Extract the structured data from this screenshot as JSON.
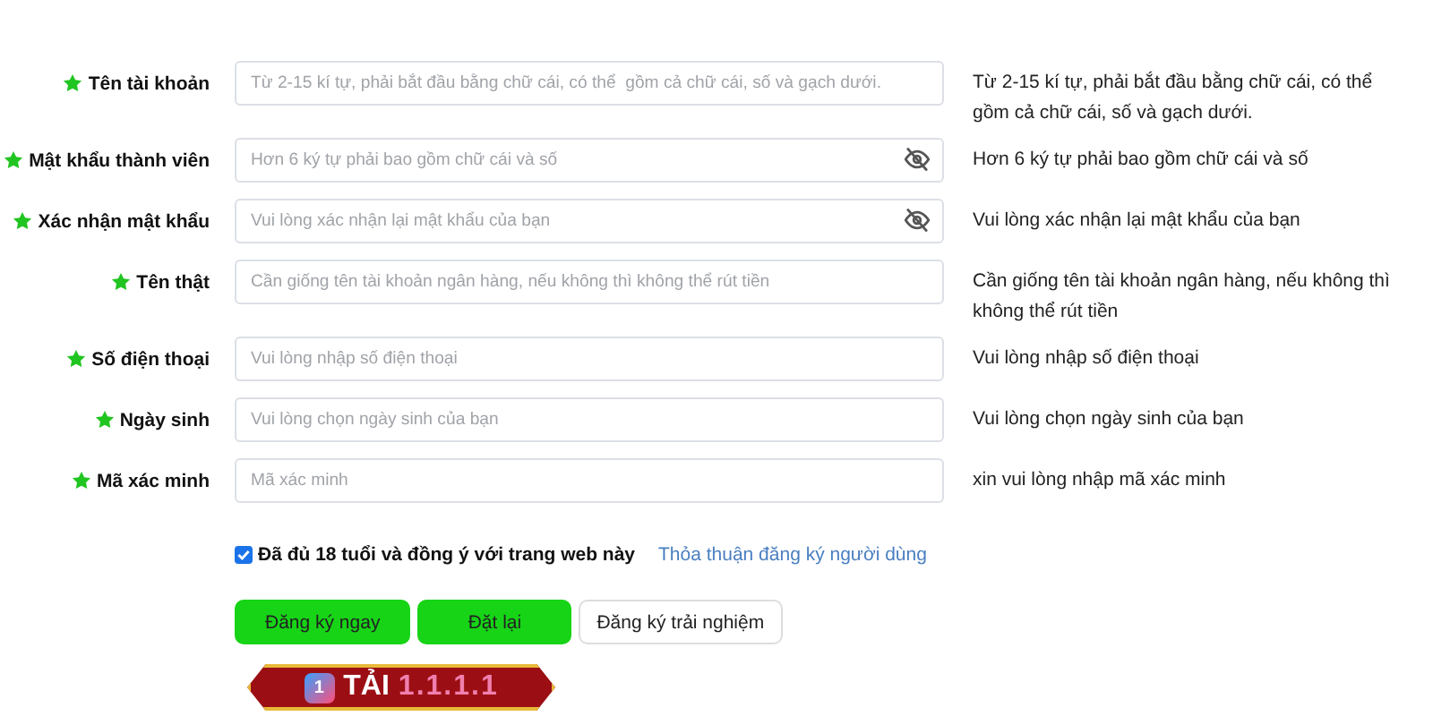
{
  "fields": [
    {
      "label": "Tên tài khoản",
      "required": true,
      "kind": "text",
      "placeholder": "Từ 2-15 kí tự, phải bắt đầu bằng chữ cái, có thể  gồm cả chữ cái, số và gạch dưới.",
      "hint": "Từ 2-15 kí tự, phải bắt đầu bằng chữ cái, có thể gồm cả chữ cái, số và gạch dưới."
    },
    {
      "label": "Mật khẩu thành viên",
      "required": true,
      "kind": "password",
      "placeholder": "Hơn 6 ký tự phải bao gồm chữ cái và số",
      "hint": "Hơn 6 ký tự phải bao gồm chữ cái và số"
    },
    {
      "label": "Xác nhận mật khẩu",
      "required": true,
      "kind": "password",
      "placeholder": "Vui lòng xác nhận lại mật khẩu của bạn",
      "hint": "Vui lòng xác nhận lại mật khẩu của bạn"
    },
    {
      "label": "Tên thật",
      "required": true,
      "kind": "text",
      "placeholder": "Cần giống tên tài khoản ngân hàng, nếu không thì không thể rút tiền",
      "hint": "Cần giống tên tài khoản ngân hàng, nếu không thì không thể rút tiền"
    },
    {
      "label": "Số điện thoại",
      "required": true,
      "kind": "text",
      "placeholder": "Vui lòng nhập số điện thoại",
      "hint": "Vui lòng nhập số điện thoại"
    },
    {
      "label": "Ngày sinh",
      "required": true,
      "kind": "text",
      "placeholder": "Vui lòng chọn ngày sinh của bạn",
      "hint": "Vui lòng chọn ngày sinh của bạn"
    },
    {
      "label": "Mã xác minh",
      "required": true,
      "kind": "text",
      "placeholder": "Mã xác minh",
      "hint": "xin vui lòng nhập mã xác minh"
    }
  ],
  "agreement": {
    "checked": true,
    "label": "Đã đủ 18 tuổi và đồng ý với trang web này",
    "link": "Thỏa thuận đăng ký người dùng"
  },
  "buttons": [
    {
      "label": "Đăng ký ngay",
      "kind": "primary"
    },
    {
      "label": "Đặt lại",
      "kind": "primary"
    },
    {
      "label": "Đăng ký trải nghiệm",
      "kind": "secondary"
    }
  ],
  "banner": {
    "badge": "1",
    "word": "TẢI",
    "number": "1.1.1.1"
  }
}
